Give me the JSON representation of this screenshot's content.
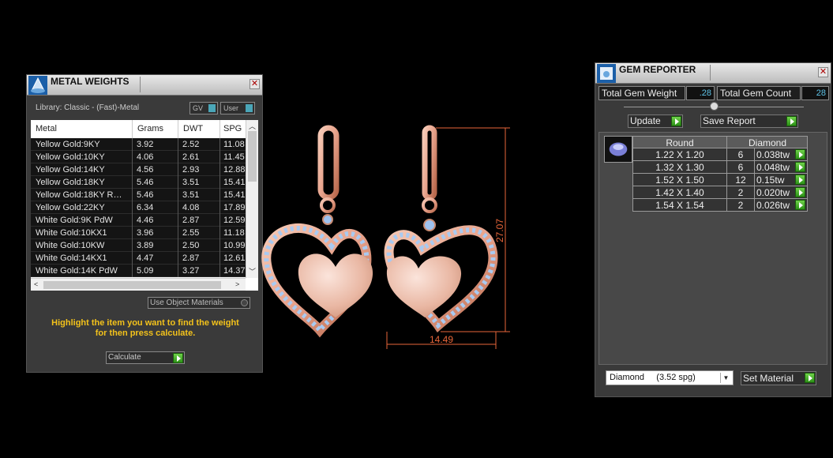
{
  "colors": {
    "background": "#000000",
    "panel": "#3a3a3a",
    "accent_yellow": "#f3c21b",
    "accent_cyan": "#5ec2e6",
    "dimension": "#e8663a",
    "metal": "#e8a38c",
    "stones": "#9ec2ef",
    "go_button": "#3fb422"
  },
  "metal_weights": {
    "title": "METAL WEIGHTS",
    "icon": "metal-weights-icon",
    "library": "Library: Classic - (Fast)-Metal",
    "gv_toggle": "GV",
    "user_toggle": "User",
    "columns": [
      "Metal",
      "Grams",
      "DWT",
      "SPG"
    ],
    "rows": [
      {
        "metal": "Yellow Gold:9KY",
        "grams": "3.92",
        "dwt": "2.52",
        "spg": "11.08"
      },
      {
        "metal": "Yellow Gold:10KY",
        "grams": "4.06",
        "dwt": "2.61",
        "spg": "11.45"
      },
      {
        "metal": "Yellow Gold:14KY",
        "grams": "4.56",
        "dwt": "2.93",
        "spg": "12.88"
      },
      {
        "metal": "Yellow Gold:18KY",
        "grams": "5.46",
        "dwt": "3.51",
        "spg": "15.41"
      },
      {
        "metal": "Yellow Gold:18KY R…",
        "grams": "5.46",
        "dwt": "3.51",
        "spg": "15.41"
      },
      {
        "metal": "Yellow Gold:22KY",
        "grams": "6.34",
        "dwt": "4.08",
        "spg": "17.89"
      },
      {
        "metal": "White Gold:9K PdW",
        "grams": "4.46",
        "dwt": "2.87",
        "spg": "12.59"
      },
      {
        "metal": "White Gold:10KX1",
        "grams": "3.96",
        "dwt": "2.55",
        "spg": "11.18"
      },
      {
        "metal": "White Gold:10KW",
        "grams": "3.89",
        "dwt": "2.50",
        "spg": "10.99"
      },
      {
        "metal": "White Gold:14KX1",
        "grams": "4.47",
        "dwt": "2.87",
        "spg": "12.61"
      },
      {
        "metal": "White Gold:14K PdW",
        "grams": "5.09",
        "dwt": "3.27",
        "spg": "14.37"
      }
    ],
    "use_object_materials": "Use Object Materials",
    "hint_line1": "Highlight the item you want to find the weight",
    "hint_line2": "for then press calculate.",
    "calculate": "Calculate"
  },
  "viewport": {
    "height_dimension": "27.07",
    "width_dimension": "14.49"
  },
  "gem_reporter": {
    "title": "GEM REPORTER",
    "icon": "gem-reporter-icon",
    "total_weight_label": "Total Gem Weight",
    "total_weight": ".28",
    "total_count_label": "Total Gem Count",
    "total_count": "28",
    "update": "Update",
    "save_report": "Save Report",
    "table_headers": [
      "Round",
      "Diamond"
    ],
    "gems": [
      {
        "size": "1.22 X 1.20",
        "count": "6",
        "weight": "0.038tw"
      },
      {
        "size": "1.32 X 1.30",
        "count": "6",
        "weight": "0.048tw"
      },
      {
        "size": "1.52 X 1.50",
        "count": "12",
        "weight": "0.15tw"
      },
      {
        "size": "1.42 X 1.40",
        "count": "2",
        "weight": "0.020tw"
      },
      {
        "size": "1.54 X 1.54",
        "count": "2",
        "weight": "0.026tw"
      }
    ],
    "material_select": "Diamond     (3.52 spg)",
    "set_material": "Set Material"
  }
}
